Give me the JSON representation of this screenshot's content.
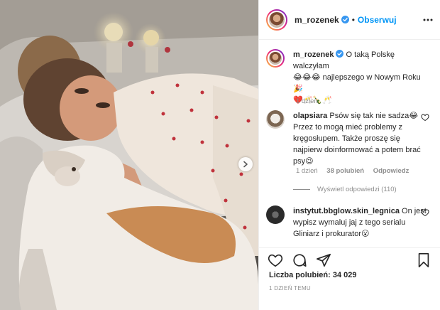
{
  "post": {
    "username": "m_rozenek",
    "follow_label": "Obserwuj",
    "dot": "•"
  },
  "caption": {
    "username": "m_rozenek",
    "text_line1": " O taką Polskę walczyłam",
    "text_line2": "😂😂😂 najlepszego w Nowym Roku 🎉",
    "text_line3": "❤️🥂🍾🥂",
    "time": "1 dzień"
  },
  "comments": [
    {
      "username": "olapsiara",
      "text": " Psów się tak nie sadza😂 Przez to mogą mieć problemy z kręgosłupem. Także proszę się najpierw doinformować a potem brać psy😉",
      "time": "1 dzień",
      "likes": "38 polubień",
      "reply": "Odpowiedz"
    },
    {
      "username": "instytut.bbglow.skin_legnica",
      "text": " On jest wypisz wymaluj jaj z tego serialu Gliniarz i prokurator😮"
    }
  ],
  "view_replies": "Wyświetl odpowiedzi (110)",
  "likes_label": "Liczba polubień: 34 029",
  "post_age": "1 DZIEŃ TEMU",
  "icons": [
    "heart-icon",
    "comment-icon",
    "share-icon",
    "bookmark-icon",
    "more-icon",
    "verified-icon",
    "chevron-right-icon"
  ],
  "colors": {
    "accent": "#0095f6",
    "text": "#262626",
    "muted": "#8e8e8e",
    "border": "#efefef"
  }
}
